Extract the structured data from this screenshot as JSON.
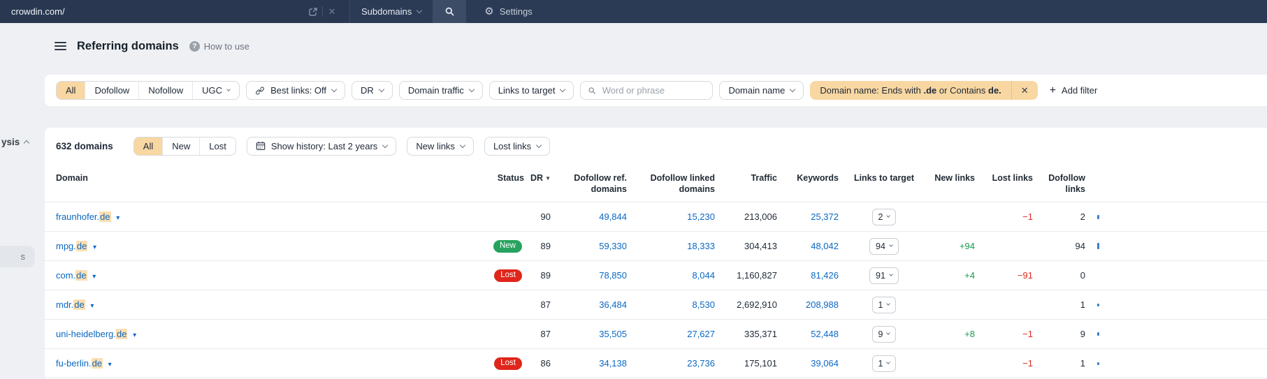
{
  "colors": {
    "accent": "#f8d7a2",
    "link": "#0b68c3",
    "red": "#dc2b21",
    "green": "#199a4c",
    "topbar": "#2c3b55",
    "badge_new": "#27a35f",
    "badge_lost": "#e0261c"
  },
  "icons": {
    "gear": "⚙",
    "help": "?",
    "close": "✕",
    "plus": "+",
    "sort_desc": "▼",
    "domain_caret": "▾"
  },
  "topbar": {
    "target": "crowdin.com/",
    "scope": "Subdomains",
    "settings_label": "Settings"
  },
  "page_header": {
    "title": "Referring domains",
    "help_label": "How to use"
  },
  "rail": {
    "group_label": "ysis",
    "item_label": "s"
  },
  "filter_bar": {
    "type_tabs": [
      "All",
      "Dofollow",
      "Nofollow",
      "UGC"
    ],
    "best_links_label": "Best links: Off",
    "dr_label": "DR",
    "domain_traffic_label": "Domain traffic",
    "links_to_target_label": "Links to target",
    "search_placeholder": "Word or phrase",
    "domain_name_label": "Domain name",
    "chip": {
      "text_1": "Domain name: Ends with ",
      "bold_1": ".de",
      "text_2": " or Contains ",
      "bold_2": "de."
    },
    "add_filter_label": "Add filter"
  },
  "toolbar": {
    "count_label": "632 domains",
    "history_tabs": [
      "All",
      "New",
      "Lost"
    ],
    "show_history_label": "Show history: Last 2 years",
    "new_links_label": "New links",
    "lost_links_label": "Lost links"
  },
  "table": {
    "headers": [
      "Domain",
      "Status",
      "DR",
      "Dofollow ref. domains",
      "Dofollow linked domains",
      "Traffic",
      "Keywords",
      "Links to target",
      "New links",
      "Lost links",
      "Dofollow links"
    ],
    "rows": [
      {
        "prefix": "fraunhofer",
        "match": "de",
        "status": "",
        "dr": "90",
        "dofollow_ref": "49,844",
        "dofollow_linked": "15,230",
        "traffic": "213,006",
        "keywords": "25,372",
        "links_to_target": "2",
        "new_links": "",
        "lost_links": "−1",
        "dofollow_links": "2",
        "bar": 6
      },
      {
        "prefix": "mpg",
        "match": "de",
        "status": "New",
        "dr": "89",
        "dofollow_ref": "59,330",
        "dofollow_linked": "18,333",
        "traffic": "304,413",
        "keywords": "48,042",
        "links_to_target": "94",
        "new_links": "+94",
        "lost_links": "",
        "dofollow_links": "94",
        "bar": 9
      },
      {
        "prefix": "com",
        "match": "de",
        "status": "Lost",
        "dr": "89",
        "dofollow_ref": "78,850",
        "dofollow_linked": "8,044",
        "traffic": "1,160,827",
        "keywords": "81,426",
        "links_to_target": "91",
        "new_links": "+4",
        "lost_links": "−91",
        "dofollow_links": "0",
        "bar": 0
      },
      {
        "prefix": "mdr",
        "match": "de",
        "status": "",
        "dr": "87",
        "dofollow_ref": "36,484",
        "dofollow_linked": "8,530",
        "traffic": "2,692,910",
        "keywords": "208,988",
        "links_to_target": "1",
        "new_links": "",
        "lost_links": "",
        "dofollow_links": "1",
        "bar": 4
      },
      {
        "prefix": "uni-heidelberg",
        "match": "de",
        "status": "",
        "dr": "87",
        "dofollow_ref": "35,505",
        "dofollow_linked": "27,627",
        "traffic": "335,371",
        "keywords": "52,448",
        "links_to_target": "9",
        "new_links": "+8",
        "lost_links": "−1",
        "dofollow_links": "9",
        "bar": 5
      },
      {
        "prefix": "fu-berlin",
        "match": "de",
        "status": "Lost",
        "dr": "86",
        "dofollow_ref": "34,138",
        "dofollow_linked": "23,736",
        "traffic": "175,101",
        "keywords": "39,064",
        "links_to_target": "1",
        "new_links": "",
        "lost_links": "−1",
        "dofollow_links": "1",
        "bar": 4
      }
    ]
  }
}
